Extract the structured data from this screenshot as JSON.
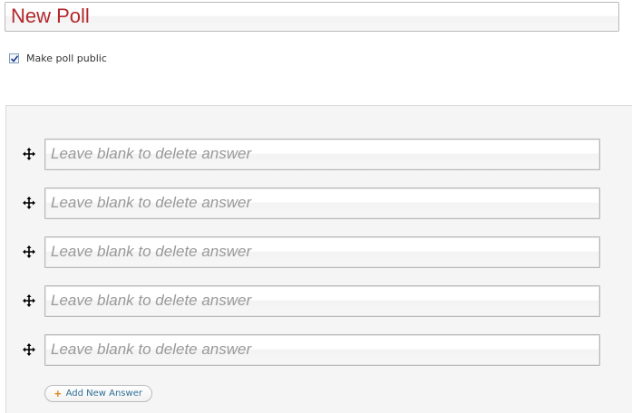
{
  "poll": {
    "title_value": "New Poll"
  },
  "public_option": {
    "label": "Make poll public",
    "checked": true
  },
  "answers": {
    "placeholder": "Leave blank to delete answer",
    "drag_icon": "move-arrows-icon",
    "items": [
      {
        "value": ""
      },
      {
        "value": ""
      },
      {
        "value": ""
      },
      {
        "value": ""
      },
      {
        "value": ""
      }
    ],
    "add_button_label": "Add New Answer",
    "add_icon": "plus-icon"
  },
  "colors": {
    "title_text": "#b3282d",
    "add_icon": "#e08a1e",
    "add_label": "#2f6f94"
  }
}
